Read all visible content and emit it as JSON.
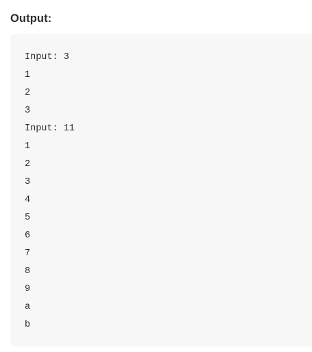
{
  "heading": "Output:",
  "output_lines": [
    "Input: 3",
    "1",
    "2",
    "3",
    "Input: 11",
    "1",
    "2",
    "3",
    "4",
    "5",
    "6",
    "7",
    "8",
    "9",
    "a",
    "b"
  ]
}
